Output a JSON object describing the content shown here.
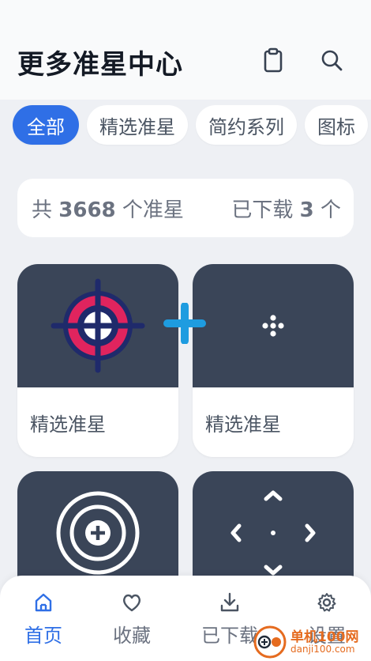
{
  "header": {
    "title": "更多准星中心",
    "icons": [
      "clipboard-icon",
      "search-icon"
    ]
  },
  "chips": [
    {
      "label": "全部",
      "active": true
    },
    {
      "label": "精选准星",
      "active": false
    },
    {
      "label": "简约系列",
      "active": false
    },
    {
      "label": "图标",
      "active": false
    }
  ],
  "stats": {
    "total_prefix": "共",
    "total_count": "3668",
    "total_suffix": "个准星",
    "downloaded_prefix": "已下载",
    "downloaded_count": "3",
    "downloaded_suffix": "个"
  },
  "cards": [
    {
      "label": "精选准星",
      "icon": "crosshair-target-icon"
    },
    {
      "label": "精选准星",
      "icon": "dot-cluster-crosshair-icon"
    },
    {
      "label": "",
      "icon": "circle-plus-crosshair-icon"
    },
    {
      "label": "",
      "icon": "chevron-arrows-crosshair-icon"
    }
  ],
  "bottom_nav": [
    {
      "label": "首页",
      "icon": "home-icon",
      "active": true
    },
    {
      "label": "收藏",
      "icon": "heart-icon",
      "active": false
    },
    {
      "label": "已下载",
      "icon": "download-icon",
      "active": false
    },
    {
      "label": "设置",
      "icon": "gear-icon",
      "active": false
    }
  ],
  "watermark": {
    "main": "单机100网",
    "sub": "danji100.com"
  },
  "colors": {
    "accent": "#2f6fe6",
    "card_dark": "#3a4558",
    "target_pink": "#e0245e",
    "target_navy": "#1f2a6b",
    "plus_blue": "#1e9ce0"
  }
}
